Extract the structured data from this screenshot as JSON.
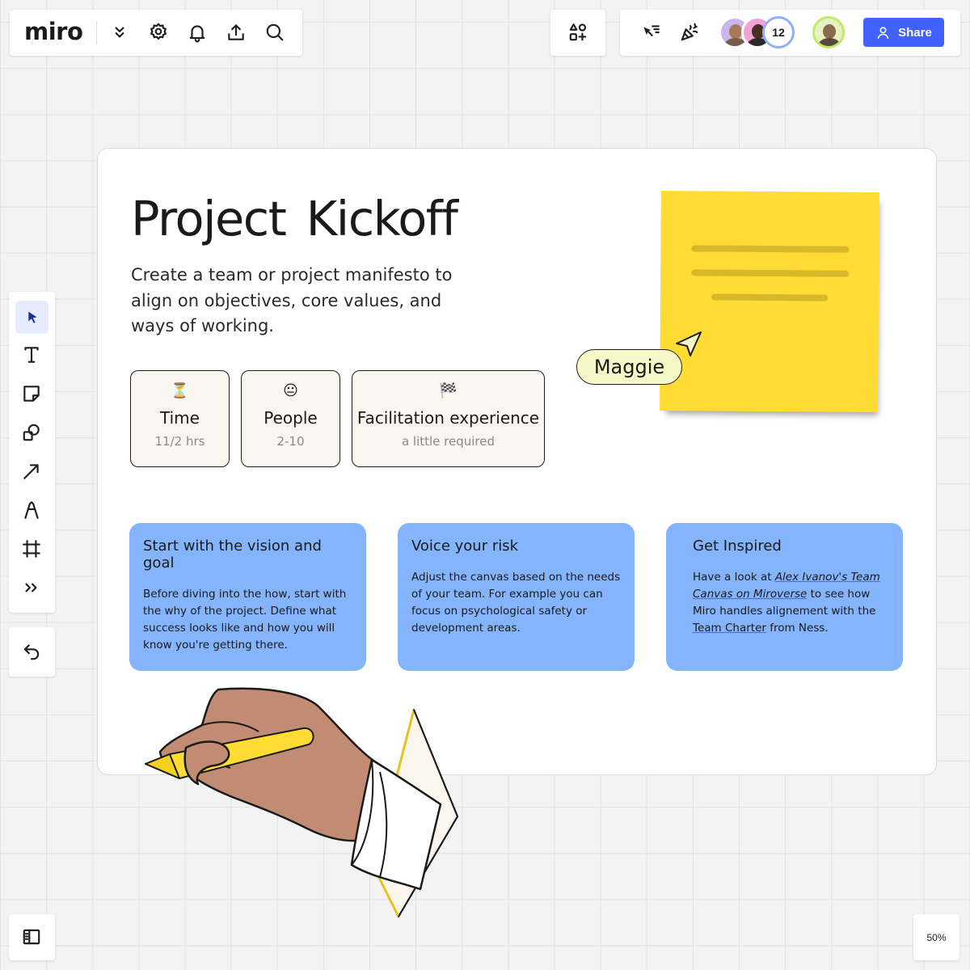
{
  "app": {
    "logo": "miro",
    "zoom": "50%"
  },
  "toolbar_top": {
    "collaborators_count": "12",
    "share_label": "Share"
  },
  "board": {
    "title": "Project  Kickoff",
    "subtitle": "Create a team or project manifesto to align on objectives, core values, and ways of working.",
    "info_cards": [
      {
        "emoji": "⏳",
        "label": "Time",
        "value": "11/2 hrs"
      },
      {
        "emoji": "😐",
        "label": "People",
        "value": "2-10"
      },
      {
        "emoji": "🏁",
        "label": "Facilitation experience",
        "value": "a little  required"
      }
    ],
    "cards": [
      {
        "title": "Start with the vision and goal",
        "body": "Before diving into the how, start with the why of the project. Define what success looks like and how you will know you're getting there."
      },
      {
        "title": "Voice your risk",
        "body": "Adjust the canvas based on the needs of your team. For example  you can focus on psychological safety or development areas."
      },
      {
        "title": "Get Inspired",
        "body_start": "Have a look at ",
        "body_link1": "Alex Ivanov's Team Canvas on Miroverse",
        "body_mid": "  to see how Miro handles alignement with the ",
        "body_link2": "Team Charter",
        "body_end": " from Ness."
      }
    ],
    "cursor_user": "Maggie"
  },
  "colors": {
    "accent": "#4262ff",
    "sticky": "#ffdc33",
    "card_blue": "#84b4fc",
    "info_card_bg": "#f9f6f0",
    "cursor_label_bg": "#f7f8c8"
  }
}
